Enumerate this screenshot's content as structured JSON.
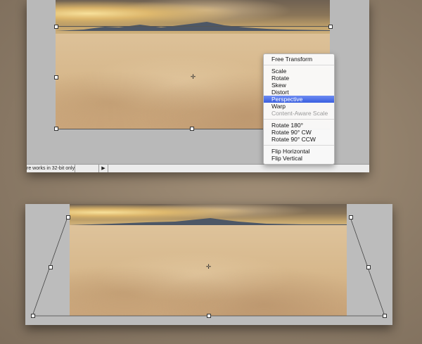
{
  "status_bar": {
    "text": "re works in 32-bit only",
    "arrow": "▶"
  },
  "context_menu": {
    "groups": [
      [
        {
          "label": "Free Transform",
          "state": "normal"
        }
      ],
      [
        {
          "label": "Scale",
          "state": "normal"
        },
        {
          "label": "Rotate",
          "state": "normal"
        },
        {
          "label": "Skew",
          "state": "normal"
        },
        {
          "label": "Distort",
          "state": "normal"
        },
        {
          "label": "Perspective",
          "state": "selected"
        },
        {
          "label": "Warp",
          "state": "normal"
        },
        {
          "label": "Content-Aware Scale",
          "state": "disabled"
        }
      ],
      [
        {
          "label": "Rotate 180°",
          "state": "normal"
        },
        {
          "label": "Rotate 90° CW",
          "state": "normal"
        },
        {
          "label": "Rotate 90° CCW",
          "state": "normal"
        }
      ],
      [
        {
          "label": "Flip Horizontal",
          "state": "normal"
        },
        {
          "label": "Flip Vertical",
          "state": "normal"
        }
      ]
    ]
  },
  "colors": {
    "background": "#8b7a66",
    "canvas_gray": "#b9b9b9",
    "menu_highlight": "#3a5fe0"
  },
  "icons": {
    "center_point": "crosshair-icon",
    "handles": "transform-handle-icon"
  }
}
